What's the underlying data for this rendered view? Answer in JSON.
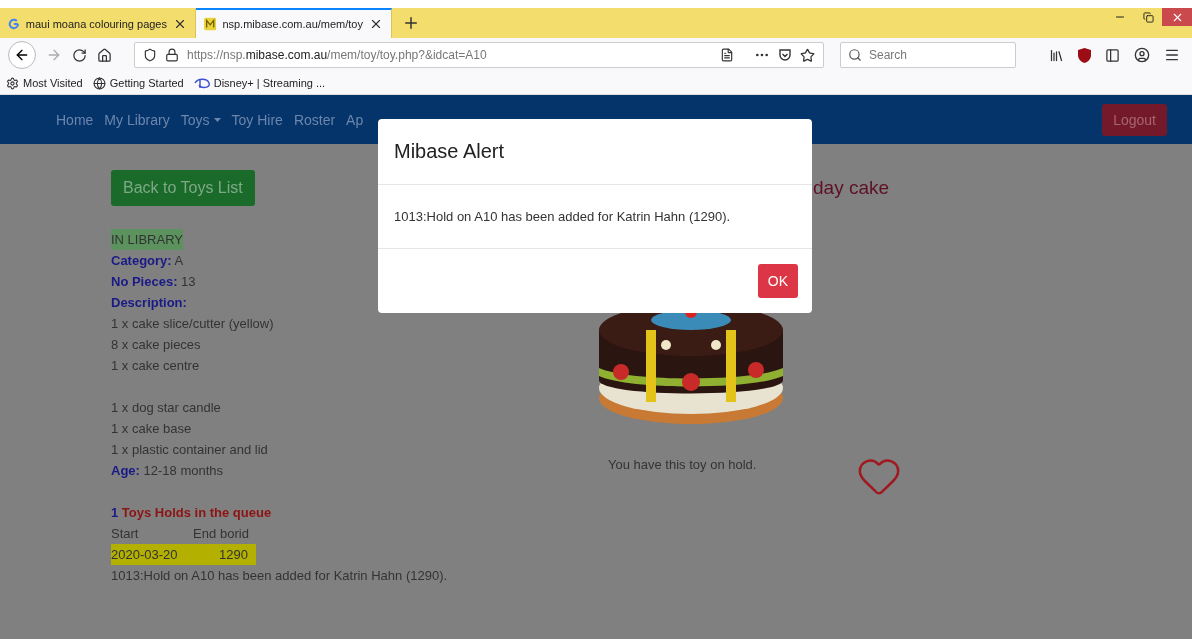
{
  "browser": {
    "tabs": [
      {
        "title": "maui moana colouring pages",
        "kind": "google",
        "selected": false
      },
      {
        "title": "nsp.mibase.com.au/mem/toy",
        "kind": "mibase",
        "selected": true
      }
    ],
    "url": "https://nsp.**mibase.com.au**/mem/toy/toy.php?&idcat=A10",
    "search": {
      "placeholder": "Search"
    },
    "bookmarks": [
      {
        "label": "Most Visited",
        "kind": "gear"
      },
      {
        "label": "Getting Started",
        "kind": "globe"
      },
      {
        "label": "Disney+ | Streaming ...",
        "kind": "disney"
      }
    ]
  },
  "nav": {
    "items": [
      {
        "label": "Home",
        "dropdown": false
      },
      {
        "label": "My Library",
        "dropdown": false
      },
      {
        "label": "Toys",
        "dropdown": true
      },
      {
        "label": "Toy Hire",
        "dropdown": false
      },
      {
        "label": "Roster",
        "dropdown": false
      },
      {
        "label": "Ap",
        "dropdown": false
      }
    ],
    "logout": "Logout"
  },
  "toy": {
    "back_button": "Back to Toys List",
    "status": "IN LIBRARY",
    "fields": [
      {
        "label": "Category:",
        "value": "A"
      },
      {
        "label": "No Pieces:",
        "value": "13"
      }
    ],
    "description_label": "Description:",
    "description_groups": [
      [
        "1 x cake slice/cutter (yellow)",
        "8 x cake pieces",
        "1 x cake centre"
      ],
      [
        "1 x dog star candle",
        "1 x cake base",
        "1 x plastic container and lid"
      ]
    ],
    "age": {
      "label": "Age:",
      "value": "12-18 months"
    },
    "queue": {
      "count": "1",
      "title": "Toys Holds in the queue",
      "columns": [
        "Start",
        "End",
        "borid"
      ],
      "rows": [
        {
          "start": "2020-03-20",
          "borid": "1290"
        }
      ]
    },
    "message": "1013:Hold on A10 has been added for Katrin Hahn (1290).",
    "title": "day cake",
    "hold_note": "You have this toy on hold."
  },
  "modal": {
    "title": "Mibase Alert",
    "message": "1013:Hold on A10 has been added for Katrin Hahn (1290).",
    "ok": "OK"
  }
}
